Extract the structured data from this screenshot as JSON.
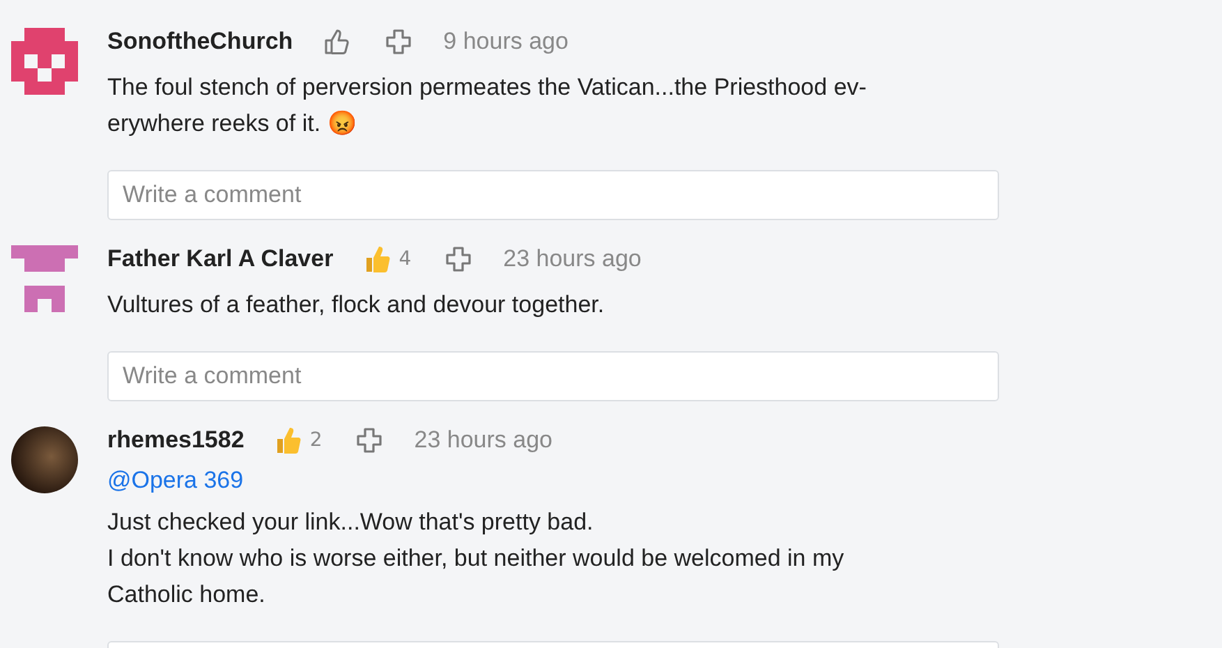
{
  "comments": [
    {
      "author": "SonoftheChurch",
      "avatar": {
        "kind": "identicon",
        "color": "#e0426e"
      },
      "time": "9 hours ago",
      "text": "The foul stench of perversion permeates the Vatican...the Priesthood ev-\nerywhere reeks of it. 😡",
      "reply_field": {
        "kind": "input",
        "placeholder": "Write a comment"
      }
    },
    {
      "author": "Father Karl A Claver",
      "avatar": {
        "kind": "identicon",
        "color": "#cc6fb3"
      },
      "likes": "4",
      "time": "23 hours ago",
      "text": "Vultures of a feather, flock and devour together.",
      "reply_field": {
        "kind": "input",
        "placeholder": "Write a comment"
      }
    },
    {
      "author": "rhemes1582",
      "avatar": {
        "kind": "photo"
      },
      "likes": "2",
      "time": "23 hours ago",
      "mention": "@Opera 369",
      "text": "Just checked your link...Wow that's pretty bad.\nI don't know who is worse either, but neither would be welcomed in my\nCatholic home.",
      "reply_field": {
        "kind": "input"
      }
    }
  ]
}
